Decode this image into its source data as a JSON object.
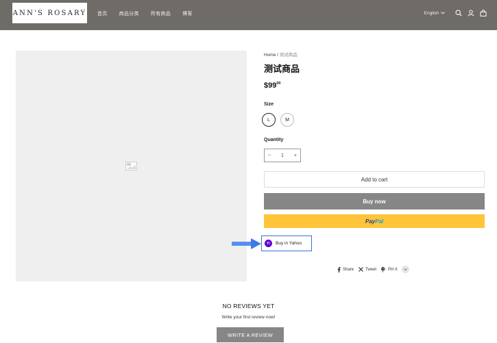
{
  "header": {
    "logo_text": "ANN'S ROSARY",
    "nav": [
      {
        "label": "首页"
      },
      {
        "label": "商品分类"
      },
      {
        "label": "所有商品"
      },
      {
        "label": "博客"
      }
    ],
    "language": "English",
    "icons": [
      "search-icon",
      "account-icon",
      "cart-icon"
    ]
  },
  "product": {
    "breadcrumb_home": "Home",
    "breadcrumb_sep": " / ",
    "breadcrumb_current": "测试商品",
    "title": "测试商品",
    "price_main": "$99",
    "price_cents": "00",
    "size_label": "Size",
    "sizes": [
      {
        "label": "L",
        "selected": true
      },
      {
        "label": "M",
        "selected": false
      }
    ],
    "quantity_label": "Quantity",
    "quantity_minus": "−",
    "quantity_value": "1",
    "quantity_plus": "+",
    "add_to_cart": "Add to cart",
    "buy_now": "Buy now",
    "paypal_part1": "Pay",
    "paypal_part2": "Pal",
    "yahoo_badge": "Y!",
    "yahoo_label": "Buy in Yahoo",
    "share": "Share",
    "tweet": "Tweet",
    "pin": "Pin it"
  },
  "reviews": {
    "title": "NO REVIEWS YET",
    "subtitle": "Write your first review now!",
    "button": "WRITE A REVIEW"
  },
  "colors": {
    "header_bg": "#6f6b66",
    "buy_now_bg": "#878686",
    "paypal_bg": "#ffc439",
    "yahoo_border": "#3a6fd8",
    "arrow": "#5a8ef0"
  }
}
